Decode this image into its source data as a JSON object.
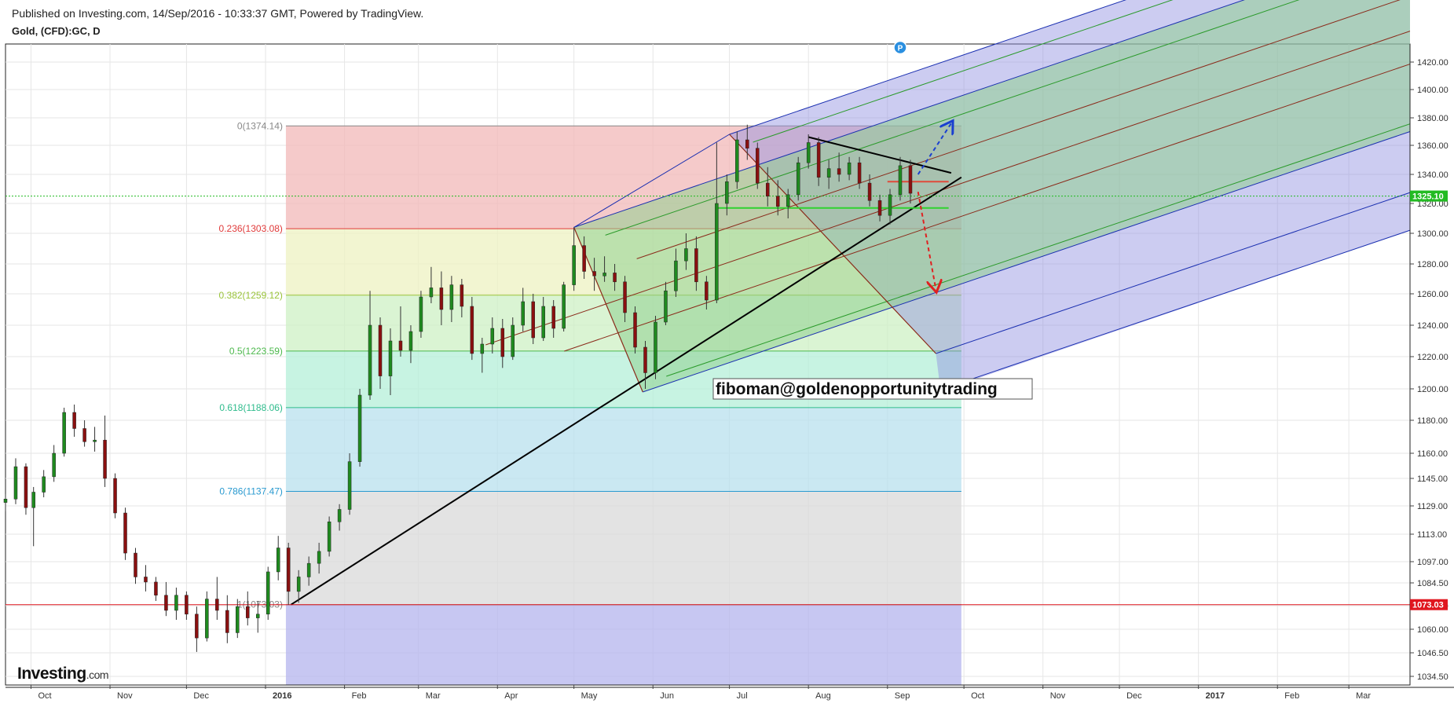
{
  "header": {
    "published": "Published on Investing.com, 14/Sep/2016 - 10:33:37 GMT, Powered by TradingView.",
    "symbol": "Gold, (CFD):GC, D"
  },
  "brand": {
    "name": "Investing",
    "suffix": ".com"
  },
  "annotation_text": "fiboman@goldenopportunitytrading",
  "chart_data": {
    "type": "candlestick",
    "title": "Gold, (CFD):GC, D",
    "x_axis": {
      "range": [
        "2015-09-21",
        "2017-03-25"
      ],
      "ticks": [
        {
          "label": "Oct",
          "date": "2015-10-01"
        },
        {
          "label": "Nov",
          "date": "2015-11-01"
        },
        {
          "label": "Dec",
          "date": "2015-12-01"
        },
        {
          "label": "2016",
          "date": "2016-01-01"
        },
        {
          "label": "Feb",
          "date": "2016-02-01"
        },
        {
          "label": "Mar",
          "date": "2016-03-01"
        },
        {
          "label": "Apr",
          "date": "2016-04-01"
        },
        {
          "label": "May",
          "date": "2016-05-01"
        },
        {
          "label": "Jun",
          "date": "2016-06-01"
        },
        {
          "label": "Jul",
          "date": "2016-07-01"
        },
        {
          "label": "Aug",
          "date": "2016-08-01"
        },
        {
          "label": "Sep",
          "date": "2016-09-01"
        },
        {
          "label": "Oct",
          "date": "2016-10-01"
        },
        {
          "label": "Nov",
          "date": "2016-11-01"
        },
        {
          "label": "Dec",
          "date": "2016-12-01"
        },
        {
          "label": "2017",
          "date": "2017-01-01"
        },
        {
          "label": "Feb",
          "date": "2017-02-01"
        },
        {
          "label": "Mar",
          "date": "2017-03-01"
        }
      ]
    },
    "y_axis": {
      "ticks": [
        1034.5,
        1046.5,
        1060.0,
        1072.5,
        1084.5,
        1097.0,
        1113.0,
        1129.0,
        1145.0,
        1160.0,
        1180.0,
        1200.0,
        1220.0,
        1240.0,
        1260.0,
        1280.0,
        1300.0,
        1320.0,
        1340.0,
        1360.0,
        1380.0,
        1400.0,
        1420.0
      ],
      "tick_labels": [
        "1034.50",
        "1046.50",
        "1060.00",
        "1072.50",
        "1084.50",
        "1097.00",
        "1113.00",
        "1129.00",
        "1145.00",
        "1160.00",
        "1180.00",
        "1200.00",
        "1220.00",
        "1240.00",
        "1260.00",
        "1280.00",
        "1300.00",
        "1320.00",
        "1340.00",
        "1360.00",
        "1380.00",
        "1400.00",
        "1420.00"
      ]
    },
    "price_markers": [
      {
        "label": "1325.10",
        "value": 1325.1,
        "color": "#22bb22"
      },
      {
        "label": "1073.03",
        "value": 1073.03,
        "color": "#e0161f"
      }
    ],
    "fib_retracement": {
      "start_date": "2016-01-09",
      "end_date": "2016-09-30",
      "levels": [
        {
          "label": "0(1374.14)",
          "value": 1374.14,
          "color": "#888888",
          "fill": "#f2b8b8"
        },
        {
          "label": "0.236(1303.08)",
          "value": 1303.08,
          "color": "#e03a3a",
          "fill": "#eef2c2"
        },
        {
          "label": "0.382(1259.12)",
          "value": 1259.12,
          "color": "#9ac43a",
          "fill": "#cdf0c4"
        },
        {
          "label": "0.5(1223.59)",
          "value": 1223.59,
          "color": "#4cb84c",
          "fill": "#b4efd8"
        },
        {
          "label": "0.618(1188.06)",
          "value": 1188.06,
          "color": "#2ebb8c",
          "fill": "#b8e0ee"
        },
        {
          "label": "0.786(1137.47)",
          "value": 1137.47,
          "color": "#2a9ad0",
          "fill": "#d9d9d9"
        },
        {
          "label": "1(1073.03)",
          "value": 1073.03,
          "color": "#888888",
          "fill": "#b4b4ee"
        }
      ],
      "bottom_value": 1030
    },
    "trendline": [
      {
        "date": "2016-01-11",
        "value": 1073.03
      },
      {
        "date": "2016-09-30",
        "value": 1338
      }
    ],
    "wedge_line": [
      {
        "date": "2016-08-01",
        "value": 1366
      },
      {
        "date": "2016-09-26",
        "value": 1341
      }
    ],
    "horizontal_segments": [
      {
        "from": "2016-06-26",
        "to": "2016-09-25",
        "value": 1317,
        "color": "#2fd22f"
      },
      {
        "from": "2016-09-01",
        "to": "2016-09-25",
        "value": 1335,
        "color": "#e04a3a"
      }
    ],
    "pitchfork": {
      "outer_lower_line": [
        {
          "date": "2016-05-28",
          "value": 1198
        },
        {
          "date": "2017-03-25",
          "value": 1370
        }
      ],
      "upper_line": [
        {
          "date": "2016-05-01",
          "value": 1304
        },
        {
          "date": "2016-11-20",
          "value": 1430
        }
      ],
      "handle": [
        {
          "date": "2016-07-01",
          "value": 1368
        },
        {
          "date": "2016-09-20",
          "value": 1222
        }
      ]
    },
    "arrows": [
      {
        "from_date": "2016-09-13",
        "from_value": 1340,
        "to_date": "2016-09-26",
        "to_value": 1376,
        "color": "#1a3fd0"
      },
      {
        "from_date": "2016-09-13",
        "from_value": 1328,
        "to_date": "2016-09-20",
        "to_value": 1263,
        "color": "#e02020"
      }
    ],
    "marker": {
      "label": "P",
      "date": "2016-09-06",
      "value": 1350
    },
    "candles": [
      {
        "date": "2015-09-21",
        "open": 1131,
        "high": 1136,
        "low": 1126,
        "close": 1133
      },
      {
        "date": "2015-09-25",
        "open": 1133,
        "high": 1157,
        "low": 1130,
        "close": 1152
      },
      {
        "date": "2015-09-29",
        "open": 1152,
        "high": 1154,
        "low": 1124,
        "close": 1128
      },
      {
        "date": "2015-10-02",
        "open": 1128,
        "high": 1140,
        "low": 1106,
        "close": 1137
      },
      {
        "date": "2015-10-06",
        "open": 1137,
        "high": 1150,
        "low": 1134,
        "close": 1146
      },
      {
        "date": "2015-10-10",
        "open": 1146,
        "high": 1165,
        "low": 1143,
        "close": 1160
      },
      {
        "date": "2015-10-14",
        "open": 1160,
        "high": 1188,
        "low": 1158,
        "close": 1185
      },
      {
        "date": "2015-10-18",
        "open": 1185,
        "high": 1190,
        "low": 1170,
        "close": 1175
      },
      {
        "date": "2015-10-22",
        "open": 1175,
        "high": 1180,
        "low": 1164,
        "close": 1167
      },
      {
        "date": "2015-10-26",
        "open": 1167,
        "high": 1176,
        "low": 1161,
        "close": 1168
      },
      {
        "date": "2015-10-30",
        "open": 1168,
        "high": 1183,
        "low": 1140,
        "close": 1145
      },
      {
        "date": "2015-11-03",
        "open": 1145,
        "high": 1148,
        "low": 1122,
        "close": 1125
      },
      {
        "date": "2015-11-07",
        "open": 1125,
        "high": 1128,
        "low": 1098,
        "close": 1102
      },
      {
        "date": "2015-11-11",
        "open": 1102,
        "high": 1105,
        "low": 1084,
        "close": 1088
      },
      {
        "date": "2015-11-15",
        "open": 1088,
        "high": 1095,
        "low": 1080,
        "close": 1085
      },
      {
        "date": "2015-11-19",
        "open": 1085,
        "high": 1088,
        "low": 1075,
        "close": 1078
      },
      {
        "date": "2015-11-23",
        "open": 1078,
        "high": 1085,
        "low": 1067,
        "close": 1070
      },
      {
        "date": "2015-11-27",
        "open": 1070,
        "high": 1082,
        "low": 1065,
        "close": 1078
      },
      {
        "date": "2015-12-01",
        "open": 1078,
        "high": 1080,
        "low": 1065,
        "close": 1068
      },
      {
        "date": "2015-12-05",
        "open": 1068,
        "high": 1072,
        "low": 1047,
        "close": 1055
      },
      {
        "date": "2015-12-09",
        "open": 1055,
        "high": 1080,
        "low": 1053,
        "close": 1076
      },
      {
        "date": "2015-12-13",
        "open": 1076,
        "high": 1088,
        "low": 1065,
        "close": 1070
      },
      {
        "date": "2015-12-17",
        "open": 1070,
        "high": 1078,
        "low": 1052,
        "close": 1058
      },
      {
        "date": "2015-12-21",
        "open": 1058,
        "high": 1076,
        "low": 1055,
        "close": 1072
      },
      {
        "date": "2015-12-25",
        "open": 1072,
        "high": 1080,
        "low": 1062,
        "close": 1066
      },
      {
        "date": "2015-12-29",
        "open": 1066,
        "high": 1075,
        "low": 1058,
        "close": 1068
      },
      {
        "date": "2016-01-02",
        "open": 1068,
        "high": 1094,
        "low": 1065,
        "close": 1091
      },
      {
        "date": "2016-01-06",
        "open": 1091,
        "high": 1112,
        "low": 1086,
        "close": 1105
      },
      {
        "date": "2016-01-10",
        "open": 1105,
        "high": 1108,
        "low": 1073,
        "close": 1080
      },
      {
        "date": "2016-01-14",
        "open": 1080,
        "high": 1092,
        "low": 1074,
        "close": 1088
      },
      {
        "date": "2016-01-18",
        "open": 1088,
        "high": 1100,
        "low": 1083,
        "close": 1096
      },
      {
        "date": "2016-01-22",
        "open": 1096,
        "high": 1108,
        "low": 1090,
        "close": 1103
      },
      {
        "date": "2016-01-26",
        "open": 1103,
        "high": 1123,
        "low": 1100,
        "close": 1120
      },
      {
        "date": "2016-01-30",
        "open": 1120,
        "high": 1130,
        "low": 1115,
        "close": 1127
      },
      {
        "date": "2016-02-03",
        "open": 1127,
        "high": 1160,
        "low": 1124,
        "close": 1155
      },
      {
        "date": "2016-02-07",
        "open": 1155,
        "high": 1200,
        "low": 1152,
        "close": 1196
      },
      {
        "date": "2016-02-11",
        "open": 1196,
        "high": 1262,
        "low": 1193,
        "close": 1240
      },
      {
        "date": "2016-02-15",
        "open": 1240,
        "high": 1245,
        "low": 1200,
        "close": 1208
      },
      {
        "date": "2016-02-19",
        "open": 1208,
        "high": 1238,
        "low": 1196,
        "close": 1230
      },
      {
        "date": "2016-02-23",
        "open": 1230,
        "high": 1252,
        "low": 1220,
        "close": 1224
      },
      {
        "date": "2016-02-27",
        "open": 1224,
        "high": 1240,
        "low": 1216,
        "close": 1236
      },
      {
        "date": "2016-03-02",
        "open": 1236,
        "high": 1262,
        "low": 1232,
        "close": 1258
      },
      {
        "date": "2016-03-06",
        "open": 1258,
        "high": 1278,
        "low": 1254,
        "close": 1264
      },
      {
        "date": "2016-03-10",
        "open": 1264,
        "high": 1275,
        "low": 1240,
        "close": 1250
      },
      {
        "date": "2016-03-14",
        "open": 1250,
        "high": 1272,
        "low": 1242,
        "close": 1266
      },
      {
        "date": "2016-03-18",
        "open": 1266,
        "high": 1270,
        "low": 1245,
        "close": 1252
      },
      {
        "date": "2016-03-22",
        "open": 1252,
        "high": 1258,
        "low": 1218,
        "close": 1222
      },
      {
        "date": "2016-03-26",
        "open": 1222,
        "high": 1232,
        "low": 1210,
        "close": 1228
      },
      {
        "date": "2016-03-30",
        "open": 1228,
        "high": 1245,
        "low": 1222,
        "close": 1238
      },
      {
        "date": "2016-04-03",
        "open": 1238,
        "high": 1244,
        "low": 1213,
        "close": 1220
      },
      {
        "date": "2016-04-07",
        "open": 1220,
        "high": 1245,
        "low": 1218,
        "close": 1240
      },
      {
        "date": "2016-04-11",
        "open": 1240,
        "high": 1264,
        "low": 1236,
        "close": 1255
      },
      {
        "date": "2016-04-15",
        "open": 1255,
        "high": 1260,
        "low": 1228,
        "close": 1232
      },
      {
        "date": "2016-04-19",
        "open": 1232,
        "high": 1258,
        "low": 1230,
        "close": 1252
      },
      {
        "date": "2016-04-23",
        "open": 1252,
        "high": 1256,
        "low": 1232,
        "close": 1238
      },
      {
        "date": "2016-04-27",
        "open": 1238,
        "high": 1268,
        "low": 1236,
        "close": 1266
      },
      {
        "date": "2016-05-01",
        "open": 1266,
        "high": 1304,
        "low": 1262,
        "close": 1292
      },
      {
        "date": "2016-05-05",
        "open": 1292,
        "high": 1298,
        "low": 1270,
        "close": 1275
      },
      {
        "date": "2016-05-09",
        "open": 1275,
        "high": 1284,
        "low": 1262,
        "close": 1272
      },
      {
        "date": "2016-05-13",
        "open": 1272,
        "high": 1285,
        "low": 1268,
        "close": 1274
      },
      {
        "date": "2016-05-17",
        "open": 1274,
        "high": 1280,
        "low": 1262,
        "close": 1268
      },
      {
        "date": "2016-05-21",
        "open": 1268,
        "high": 1272,
        "low": 1242,
        "close": 1248
      },
      {
        "date": "2016-05-25",
        "open": 1248,
        "high": 1252,
        "low": 1222,
        "close": 1226
      },
      {
        "date": "2016-05-29",
        "open": 1226,
        "high": 1230,
        "low": 1200,
        "close": 1210
      },
      {
        "date": "2016-06-02",
        "open": 1210,
        "high": 1246,
        "low": 1206,
        "close": 1242
      },
      {
        "date": "2016-06-06",
        "open": 1242,
        "high": 1268,
        "low": 1240,
        "close": 1262
      },
      {
        "date": "2016-06-10",
        "open": 1262,
        "high": 1290,
        "low": 1258,
        "close": 1282
      },
      {
        "date": "2016-06-14",
        "open": 1282,
        "high": 1300,
        "low": 1276,
        "close": 1290
      },
      {
        "date": "2016-06-18",
        "open": 1290,
        "high": 1298,
        "low": 1262,
        "close": 1268
      },
      {
        "date": "2016-06-22",
        "open": 1268,
        "high": 1272,
        "low": 1250,
        "close": 1256
      },
      {
        "date": "2016-06-26",
        "open": 1256,
        "high": 1362,
        "low": 1254,
        "close": 1320
      },
      {
        "date": "2016-06-30",
        "open": 1320,
        "high": 1340,
        "low": 1312,
        "close": 1335
      },
      {
        "date": "2016-07-04",
        "open": 1335,
        "high": 1370,
        "low": 1330,
        "close": 1364
      },
      {
        "date": "2016-07-08",
        "open": 1364,
        "high": 1375,
        "low": 1350,
        "close": 1358
      },
      {
        "date": "2016-07-12",
        "open": 1358,
        "high": 1362,
        "low": 1330,
        "close": 1334
      },
      {
        "date": "2016-07-16",
        "open": 1334,
        "high": 1345,
        "low": 1318,
        "close": 1325
      },
      {
        "date": "2016-07-20",
        "open": 1325,
        "high": 1336,
        "low": 1312,
        "close": 1318
      },
      {
        "date": "2016-07-24",
        "open": 1318,
        "high": 1330,
        "low": 1310,
        "close": 1326
      },
      {
        "date": "2016-07-28",
        "open": 1326,
        "high": 1352,
        "low": 1322,
        "close": 1348
      },
      {
        "date": "2016-08-01",
        "open": 1348,
        "high": 1368,
        "low": 1344,
        "close": 1362
      },
      {
        "date": "2016-08-05",
        "open": 1362,
        "high": 1366,
        "low": 1332,
        "close": 1338
      },
      {
        "date": "2016-08-09",
        "open": 1338,
        "high": 1350,
        "low": 1330,
        "close": 1344
      },
      {
        "date": "2016-08-13",
        "open": 1344,
        "high": 1355,
        "low": 1335,
        "close": 1340
      },
      {
        "date": "2016-08-17",
        "open": 1340,
        "high": 1352,
        "low": 1336,
        "close": 1348
      },
      {
        "date": "2016-08-21",
        "open": 1348,
        "high": 1352,
        "low": 1330,
        "close": 1334
      },
      {
        "date": "2016-08-25",
        "open": 1334,
        "high": 1340,
        "low": 1318,
        "close": 1322
      },
      {
        "date": "2016-08-29",
        "open": 1322,
        "high": 1326,
        "low": 1308,
        "close": 1312
      },
      {
        "date": "2016-09-02",
        "open": 1312,
        "high": 1330,
        "low": 1306,
        "close": 1326
      },
      {
        "date": "2016-09-06",
        "open": 1326,
        "high": 1352,
        "low": 1322,
        "close": 1346
      },
      {
        "date": "2016-09-10",
        "open": 1346,
        "high": 1350,
        "low": 1320,
        "close": 1327
      }
    ]
  }
}
